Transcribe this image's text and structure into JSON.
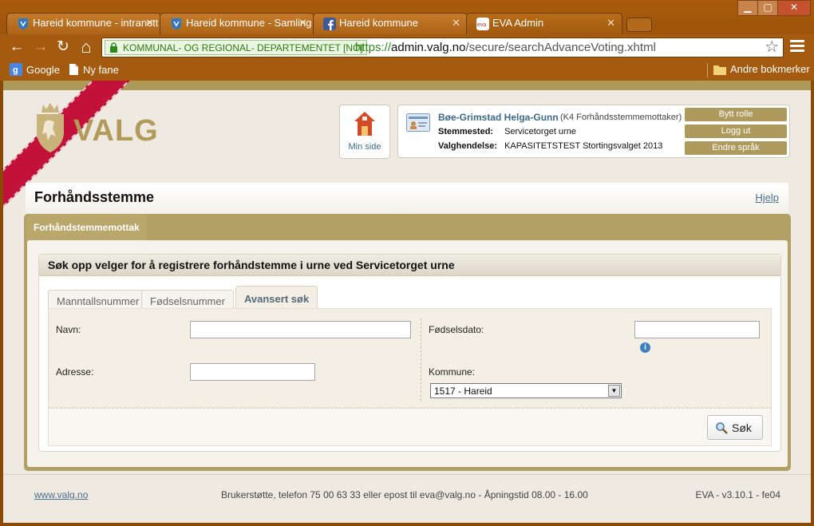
{
  "browser": {
    "tabs": [
      {
        "title": "Hareid kommune - intranett",
        "icon": "shield-icon"
      },
      {
        "title": "Hareid kommune - Samling",
        "icon": "shield-icon"
      },
      {
        "title": "Hareid kommune",
        "icon": "facebook-icon"
      },
      {
        "title": "EVA Admin",
        "icon": "eva-icon"
      }
    ],
    "window_controls": {
      "minimize": "▁",
      "maximize": "▢",
      "close": "✕"
    },
    "nav": {
      "back": "←",
      "forward": "→",
      "reload": "↻",
      "home": "⌂"
    },
    "ev_badge": "KOMMUNAL- OG REGIONAL- DEPARTEMENTET [NO]",
    "url": {
      "scheme": "https://",
      "host": "admin.valg.no",
      "path": "/secure/searchAdvanceVoting.xhtml"
    },
    "star": "☆",
    "bookmarks": [
      {
        "label": "Google",
        "icon": "google-icon"
      },
      {
        "label": "Ny fane",
        "icon": "page-icon"
      }
    ],
    "other_bookmarks": "Andre bokmerker"
  },
  "header": {
    "logo_text": "VALG",
    "min_side": "Min side",
    "user_name": "Bøe-Grimstad Helga-Gunn",
    "user_role": "(K4 Forhåndsstemmemottaker)",
    "stemmested_label": "Stemmested:",
    "stemmested_value": "Servicetorget urne",
    "valghendelse_label": "Valghendelse:",
    "valghendelse_value": "KAPASITETSTEST Stortingsvalget 2013",
    "buttons": {
      "bytt_rolle": "Bytt rolle",
      "logg_ut": "Logg ut",
      "endre_sprak": "Endre språk"
    }
  },
  "page": {
    "title": "Forhåndsstemme",
    "help": "Hjelp",
    "panel_tab": "Forhåndstemmemottak",
    "section_title": "Søk opp velger for å registrere forhåndstemme i urne ved Servicetorget urne",
    "subtabs": [
      "Manntallsnummer",
      "Fødselsnummer",
      "Avansert søk"
    ],
    "active_subtab": "Avansert søk",
    "form": {
      "navn_label": "Navn:",
      "navn_value": "",
      "adresse_label": "Adresse:",
      "adresse_value": "",
      "fodselsdato_label": "Fødselsdato:",
      "fodselsdato_value": "",
      "info_glyph": "i",
      "kommune_label": "Kommune:",
      "kommune_value": "1517 - Hareid",
      "kommune_arrow": "▼"
    },
    "search_button": "Søk"
  },
  "footer": {
    "link": "www.valg.no",
    "support": "Brukerstøtte, telefon 75 00 63 33 eller epost til eva@valg.no - Åpningstid 08.00 - 16.00",
    "version": "EVA - v3.10.1 - fe04"
  },
  "colors": {
    "chrome": "#a45a0f",
    "gold": "#b3a064",
    "ribbon": "#c2123a",
    "link": "#4c6f8c"
  }
}
